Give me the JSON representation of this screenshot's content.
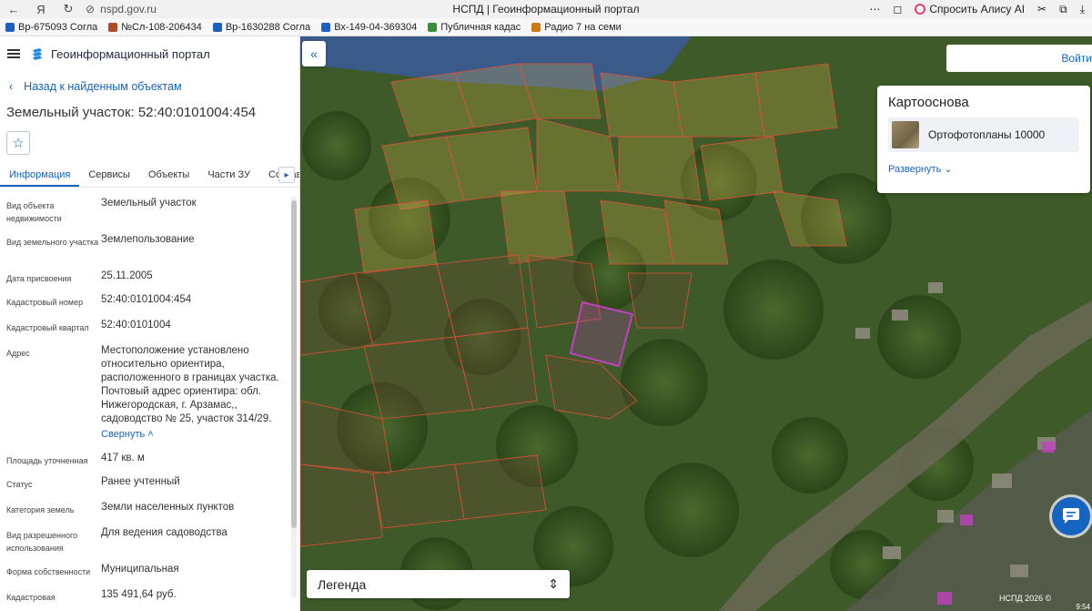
{
  "browser": {
    "url": "nspd.gov.ru",
    "tab_title": "НСПД | Геоинформационный портал",
    "alisa_label": "Спросить Алису AI"
  },
  "bookmarks": [
    {
      "label": "Вр-675093 Согла",
      "color": "#1e5fbf"
    },
    {
      "label": "№Сл-108-206434",
      "color": "#b04a2a"
    },
    {
      "label": "Вр-1630288 Согла",
      "color": "#1e5fbf"
    },
    {
      "label": "Вх-149-04-369304",
      "color": "#1e5fbf"
    },
    {
      "label": "Публичная кадас",
      "color": "#3a8f3a"
    },
    {
      "label": "Радио 7 на семи",
      "color": "#d07a12"
    }
  ],
  "portal": {
    "name": "Геоинформационный портал"
  },
  "back_link": "Назад к найденным объектам",
  "object_title": "Земельный участок: 52:40:0101004:454",
  "tabs": [
    "Информация",
    "Сервисы",
    "Объекты",
    "Части ЗУ",
    "Состав"
  ],
  "properties": [
    {
      "label": "Вид объекта недвижимости",
      "value": "Земельный участок"
    },
    {
      "label": "Вид земельного участка",
      "value": "Землепользование"
    },
    {
      "label": "Дата присвоения",
      "value": "25.11.2005"
    },
    {
      "label": "Кадастровый номер",
      "value": "52:40:0101004:454"
    },
    {
      "label": "Кадастровый квартал",
      "value": "52:40:0101004"
    },
    {
      "label": "Адрес",
      "value": "Местоположение установлено относительно ориентира, расположенного в границах участка. Почтовый адрес ориентира: обл. Нижегородская, г. Арзамас,, садоводство № 25, участок 314/29."
    },
    {
      "label": "Площадь уточненная",
      "value": "417 кв. м"
    },
    {
      "label": "Статус",
      "value": "Ранее учтенный"
    },
    {
      "label": "Категория земель",
      "value": "Земли населенных пунктов"
    },
    {
      "label": "Вид разрешенного использования",
      "value": "Для ведения садоводства"
    },
    {
      "label": "Форма собственности",
      "value": "Муниципальная"
    },
    {
      "label": "Кадастровая",
      "value": "135 491,64 руб."
    }
  ],
  "collapse_label": "Свернуть",
  "map": {
    "login_label": "Войти",
    "basemap_title": "Картооснова",
    "basemap_item": "Ортофотопланы 10000",
    "expand_label": "Развернуть",
    "legend_label": "Легенда",
    "copyright": "НСПД 2026 ©",
    "clock": "9:54"
  },
  "colors": {
    "accent": "#1565c0",
    "parcel_border": "#e0503a",
    "selected_parcel": "#c040c0"
  }
}
